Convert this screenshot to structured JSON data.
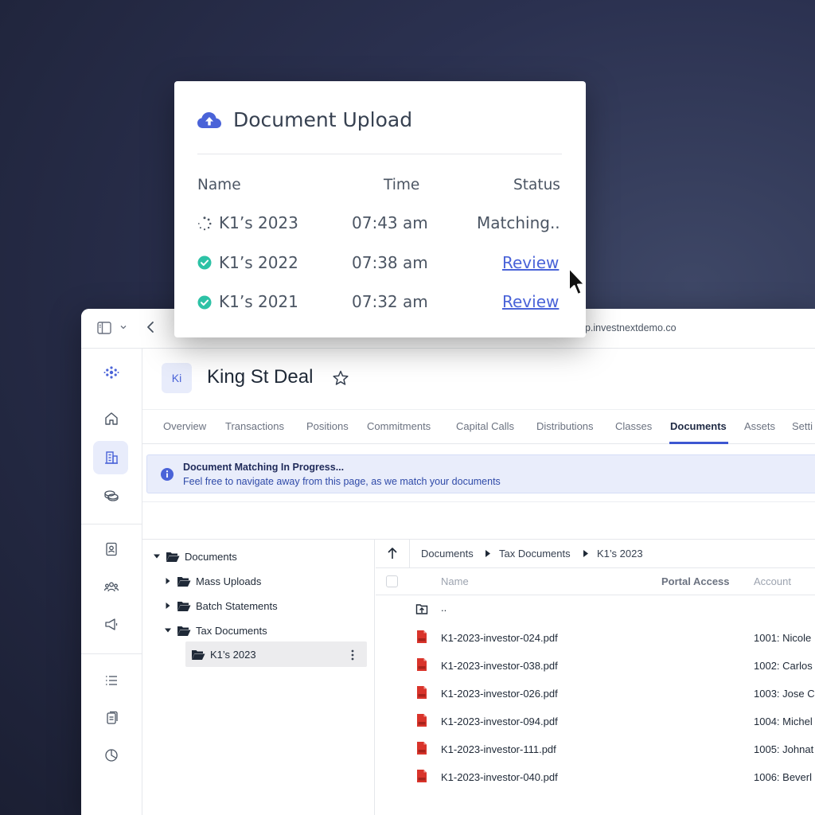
{
  "popup": {
    "title": "Document Upload",
    "headers": {
      "name": "Name",
      "time": "Time",
      "status": "Status"
    },
    "rows": [
      {
        "name": "K1’s 2023",
        "time": "07:43 am",
        "status": "Matching..",
        "state": "loading"
      },
      {
        "name": "K1’s 2022",
        "time": "07:38 am",
        "status": "Review",
        "state": "done"
      },
      {
        "name": "K1’s 2021",
        "time": "07:32 am",
        "status": "Review",
        "state": "done"
      }
    ],
    "accent": "#4a63d8",
    "success_color": "#2dc2a6"
  },
  "browser": {
    "url": "pp.investnextdemo.co"
  },
  "deal": {
    "avatar": "Ki",
    "title": "King St Deal"
  },
  "tabs": [
    "Overview",
    "Transactions",
    "Positions",
    "Commitments",
    "Capital Calls",
    "Distributions",
    "Classes",
    "Documents",
    "Assets",
    "Setti"
  ],
  "active_tab": "Documents",
  "banner": {
    "title": "Document Matching In Progress...",
    "text": "Feel free to navigate away from this page, as we match your documents"
  },
  "tree": {
    "root": "Documents",
    "items": [
      "Mass Uploads",
      "Batch Statements",
      "Tax Documents"
    ],
    "selected": "K1’s 2023"
  },
  "breadcrumb": [
    "Documents",
    "Tax Documents",
    "K1’s 2023"
  ],
  "columns": {
    "name": "Name",
    "portal_access": "Portal Access",
    "account": "Account"
  },
  "parent_dir": "..",
  "files": [
    {
      "name": "K1-2023-investor-024.pdf",
      "account": "1001: Nicole"
    },
    {
      "name": "K1-2023-investor-038.pdf",
      "account": "1002: Carlos"
    },
    {
      "name": "K1-2023-investor-026.pdf",
      "account": "1003: Jose C"
    },
    {
      "name": "K1-2023-investor-094.pdf",
      "account": "1004: Michel"
    },
    {
      "name": "K1-2023-investor-111.pdf",
      "account": "1005: Johnat"
    },
    {
      "name": "K1-2023-investor-040.pdf",
      "account": "1006: Beverl"
    }
  ]
}
